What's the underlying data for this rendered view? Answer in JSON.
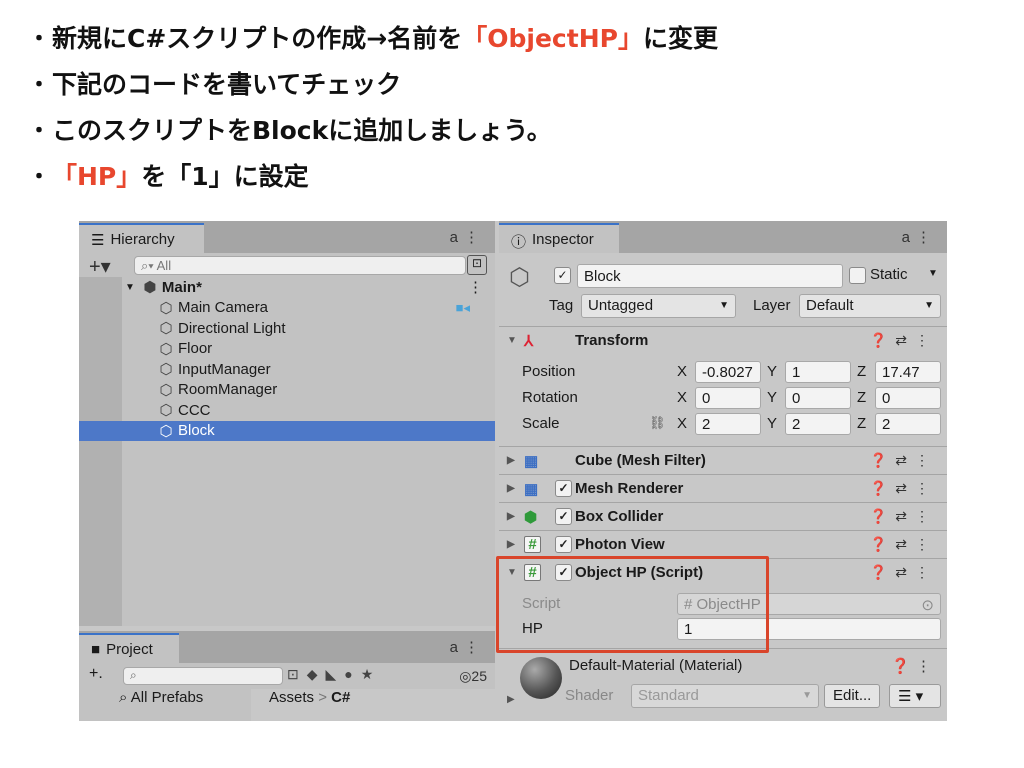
{
  "bullets": [
    {
      "pre": "新規にC#スクリプトの作成→名前を",
      "red": "「ObjectHP」",
      "post": "に変更"
    },
    {
      "pre": "下記のコードを書いてチェック",
      "red": "",
      "post": ""
    },
    {
      "pre": "このスクリプトをBlockに追加しましょう。",
      "red": "",
      "post": ""
    },
    {
      "pre": "",
      "red": "「HP」",
      "post": "を「1」に設定"
    }
  ],
  "hierarchy": {
    "tab_label": "Hierarchy",
    "add_label": "+▾",
    "search_placeholder": "All",
    "scene": "Main*",
    "objects": [
      "Main Camera",
      "Directional Light",
      "Floor",
      "InputManager",
      "RoomManager",
      "CCC",
      "Block"
    ],
    "selected": "Block"
  },
  "project": {
    "tab_label": "Project",
    "add_label": "+.",
    "hidden_count": "25",
    "left_item": "All Prefabs",
    "breadcrumb_root": "Assets",
    "breadcrumb_sep": ">",
    "breadcrumb_leaf": "C#"
  },
  "inspector": {
    "tab_label": "Inspector",
    "object_name": "Block",
    "static_label": "Static",
    "tag_label": "Tag",
    "tag_value": "Untagged",
    "layer_label": "Layer",
    "layer_value": "Default",
    "transform": {
      "title": "Transform",
      "position_label": "Position",
      "rotation_label": "Rotation",
      "scale_label": "Scale",
      "position": {
        "x": "-0.8027",
        "y": "1",
        "z": "17.47"
      },
      "rotation": {
        "x": "0",
        "y": "0",
        "z": "0"
      },
      "scale": {
        "x": "2",
        "y": "2",
        "z": "2"
      }
    },
    "components": [
      "Cube (Mesh Filter)",
      "Mesh Renderer",
      "Box Collider",
      "Photon View"
    ],
    "script_component": {
      "title": "Object HP (Script)",
      "script_label": "Script",
      "script_value": "ObjectHP",
      "hp_label": "HP",
      "hp_value": "1"
    },
    "material": {
      "name": "Default-Material (Material)",
      "shader_label": "Shader",
      "shader_value": "Standard",
      "edit_label": "Edit..."
    }
  },
  "colors": {
    "accent_red": "#e8472e",
    "selection_blue": "#4d78c8",
    "highlight_box": "#d9452b"
  }
}
